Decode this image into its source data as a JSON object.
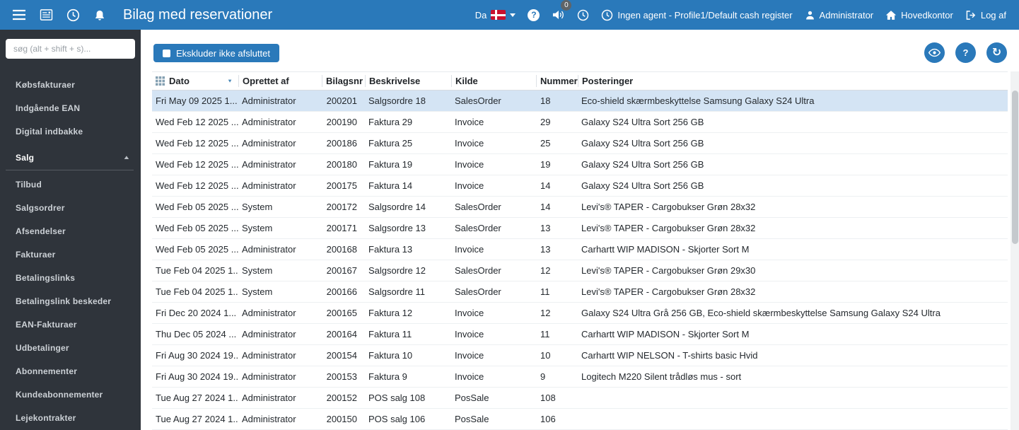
{
  "topbar": {
    "title": "Bilag med reservationer",
    "language_label": "Da",
    "notification_count": "0",
    "agent_label": "Ingen agent - Profile1/Default cash register",
    "user_label": "Administrator",
    "location_label": "Hovedkontor",
    "logout_label": "Log af"
  },
  "icons": {
    "question_mark": "?",
    "refresh": "↻",
    "chevron_up": "▲",
    "sort_caret": "▼"
  },
  "sidebar": {
    "search_placeholder": "søg (alt + shift + s)...",
    "items": [
      {
        "label": "Købsfakturaer",
        "type": "item"
      },
      {
        "label": "Indgående EAN",
        "type": "item"
      },
      {
        "label": "Digital indbakke",
        "type": "item"
      },
      {
        "label": "Salg",
        "type": "section"
      },
      {
        "label": "Tilbud",
        "type": "item"
      },
      {
        "label": "Salgsordrer",
        "type": "item"
      },
      {
        "label": "Afsendelser",
        "type": "item"
      },
      {
        "label": "Fakturaer",
        "type": "item"
      },
      {
        "label": "Betalingslinks",
        "type": "item"
      },
      {
        "label": "Betalingslink beskeder",
        "type": "item"
      },
      {
        "label": "EAN-Fakturaer",
        "type": "item"
      },
      {
        "label": "Udbetalinger",
        "type": "item"
      },
      {
        "label": "Abonnementer",
        "type": "item"
      },
      {
        "label": "Kundeabonnementer",
        "type": "item"
      },
      {
        "label": "Lejekontrakter",
        "type": "item"
      }
    ]
  },
  "toolbar": {
    "exclude_button_label": "Ekskluder ikke afsluttet"
  },
  "table": {
    "columns": [
      "Dato",
      "Oprettet af",
      "Bilagsnr",
      "Beskrivelse",
      "Kilde",
      "Nummer",
      "Posteringer"
    ],
    "rows": [
      {
        "dato": "Fri May 09 2025 1...",
        "oprettet_af": "Administrator",
        "bilagsnr": "200201",
        "beskrivelse": "Salgsordre 18",
        "kilde": "SalesOrder",
        "nummer": "18",
        "posteringer": "Eco-shield skærmbeskyttelse Samsung Galaxy S24 Ultra",
        "selected": true
      },
      {
        "dato": "Wed Feb 12 2025 ...",
        "oprettet_af": "Administrator",
        "bilagsnr": "200190",
        "beskrivelse": "Faktura 29",
        "kilde": "Invoice",
        "nummer": "29",
        "posteringer": "Galaxy S24 Ultra Sort 256 GB",
        "selected": false
      },
      {
        "dato": "Wed Feb 12 2025 ...",
        "oprettet_af": "Administrator",
        "bilagsnr": "200186",
        "beskrivelse": "Faktura 25",
        "kilde": "Invoice",
        "nummer": "25",
        "posteringer": "Galaxy S24 Ultra Sort 256 GB",
        "selected": false
      },
      {
        "dato": "Wed Feb 12 2025 ...",
        "oprettet_af": "Administrator",
        "bilagsnr": "200180",
        "beskrivelse": "Faktura 19",
        "kilde": "Invoice",
        "nummer": "19",
        "posteringer": "Galaxy S24 Ultra Sort 256 GB",
        "selected": false
      },
      {
        "dato": "Wed Feb 12 2025 ...",
        "oprettet_af": "Administrator",
        "bilagsnr": "200175",
        "beskrivelse": "Faktura 14",
        "kilde": "Invoice",
        "nummer": "14",
        "posteringer": "Galaxy S24 Ultra Sort 256 GB",
        "selected": false
      },
      {
        "dato": "Wed Feb 05 2025 ...",
        "oprettet_af": "System",
        "bilagsnr": "200172",
        "beskrivelse": "Salgsordre 14",
        "kilde": "SalesOrder",
        "nummer": "14",
        "posteringer": "Levi's® TAPER - Cargobukser Grøn 28x32",
        "selected": false
      },
      {
        "dato": "Wed Feb 05 2025 ...",
        "oprettet_af": "System",
        "bilagsnr": "200171",
        "beskrivelse": "Salgsordre 13",
        "kilde": "SalesOrder",
        "nummer": "13",
        "posteringer": "Levi's® TAPER - Cargobukser Grøn 28x32",
        "selected": false
      },
      {
        "dato": "Wed Feb 05 2025 ...",
        "oprettet_af": "Administrator",
        "bilagsnr": "200168",
        "beskrivelse": "Faktura 13",
        "kilde": "Invoice",
        "nummer": "13",
        "posteringer": "Carhartt WIP MADISON - Skjorter Sort M",
        "selected": false
      },
      {
        "dato": "Tue Feb 04 2025 1...",
        "oprettet_af": "System",
        "bilagsnr": "200167",
        "beskrivelse": "Salgsordre 12",
        "kilde": "SalesOrder",
        "nummer": "12",
        "posteringer": "Levi's® TAPER - Cargobukser Grøn 29x30",
        "selected": false
      },
      {
        "dato": "Tue Feb 04 2025 1...",
        "oprettet_af": "System",
        "bilagsnr": "200166",
        "beskrivelse": "Salgsordre 11",
        "kilde": "SalesOrder",
        "nummer": "11",
        "posteringer": "Levi's® TAPER - Cargobukser Grøn 28x32",
        "selected": false
      },
      {
        "dato": "Fri Dec 20 2024 1...",
        "oprettet_af": "Administrator",
        "bilagsnr": "200165",
        "beskrivelse": "Faktura 12",
        "kilde": "Invoice",
        "nummer": "12",
        "posteringer": "Galaxy S24 Ultra Grå 256 GB, Eco-shield skærmbeskyttelse Samsung Galaxy S24 Ultra",
        "selected": false
      },
      {
        "dato": "Thu Dec 05 2024 ...",
        "oprettet_af": "Administrator",
        "bilagsnr": "200164",
        "beskrivelse": "Faktura 11",
        "kilde": "Invoice",
        "nummer": "11",
        "posteringer": "Carhartt WIP MADISON - Skjorter Sort M",
        "selected": false
      },
      {
        "dato": "Fri Aug 30 2024 19...",
        "oprettet_af": "Administrator",
        "bilagsnr": "200154",
        "beskrivelse": "Faktura 10",
        "kilde": "Invoice",
        "nummer": "10",
        "posteringer": "Carhartt WIP NELSON - T-shirts basic Hvid",
        "selected": false
      },
      {
        "dato": "Fri Aug 30 2024 19...",
        "oprettet_af": "Administrator",
        "bilagsnr": "200153",
        "beskrivelse": "Faktura 9",
        "kilde": "Invoice",
        "nummer": "9",
        "posteringer": "Logitech M220 Silent trådløs mus - sort",
        "selected": false
      },
      {
        "dato": "Tue Aug 27 2024 1...",
        "oprettet_af": "Administrator",
        "bilagsnr": "200152",
        "beskrivelse": "POS salg 108",
        "kilde": "PosSale",
        "nummer": "108",
        "posteringer": "",
        "selected": false
      },
      {
        "dato": "Tue Aug 27 2024 1...",
        "oprettet_af": "Administrator",
        "bilagsnr": "200150",
        "beskrivelse": "POS salg 106",
        "kilde": "PosSale",
        "nummer": "106",
        "posteringer": "",
        "selected": false
      }
    ]
  }
}
